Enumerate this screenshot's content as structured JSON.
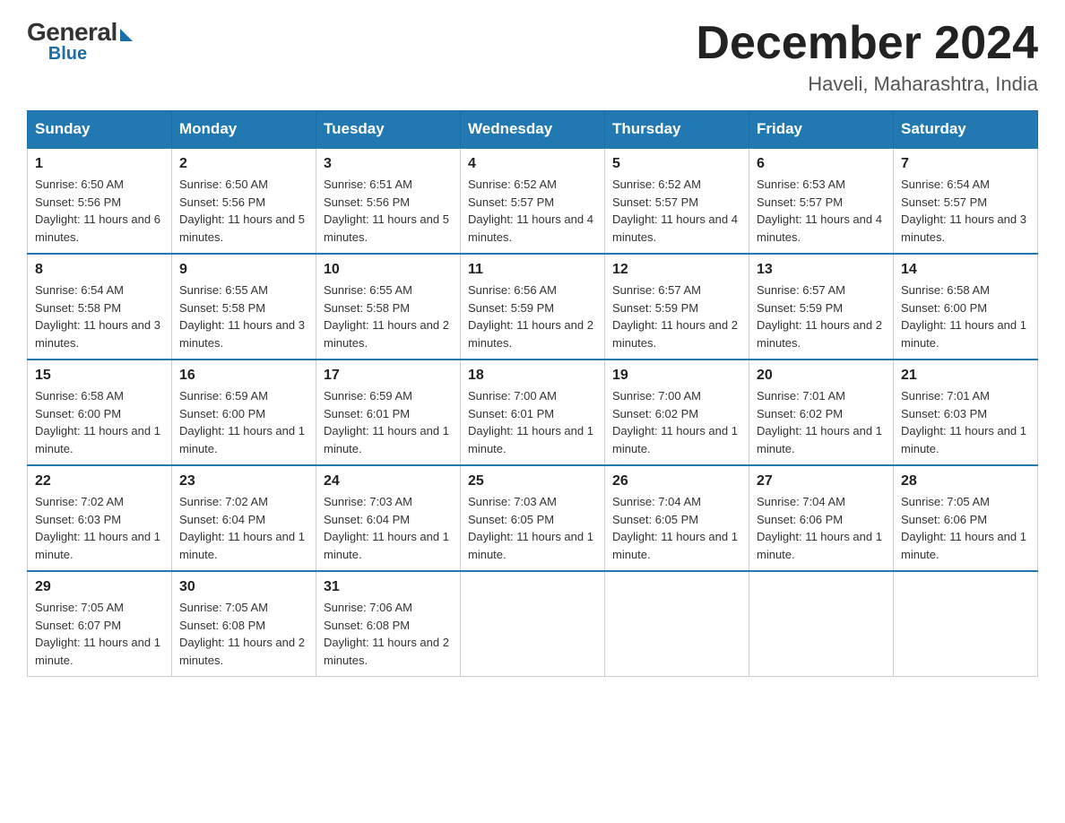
{
  "header": {
    "logo_general": "General",
    "logo_blue": "Blue",
    "month_title": "December 2024",
    "location": "Haveli, Maharashtra, India"
  },
  "days_of_week": [
    "Sunday",
    "Monday",
    "Tuesday",
    "Wednesday",
    "Thursday",
    "Friday",
    "Saturday"
  ],
  "weeks": [
    [
      {
        "day": "1",
        "sunrise": "6:50 AM",
        "sunset": "5:56 PM",
        "daylight": "11 hours and 6 minutes."
      },
      {
        "day": "2",
        "sunrise": "6:50 AM",
        "sunset": "5:56 PM",
        "daylight": "11 hours and 5 minutes."
      },
      {
        "day": "3",
        "sunrise": "6:51 AM",
        "sunset": "5:56 PM",
        "daylight": "11 hours and 5 minutes."
      },
      {
        "day": "4",
        "sunrise": "6:52 AM",
        "sunset": "5:57 PM",
        "daylight": "11 hours and 4 minutes."
      },
      {
        "day": "5",
        "sunrise": "6:52 AM",
        "sunset": "5:57 PM",
        "daylight": "11 hours and 4 minutes."
      },
      {
        "day": "6",
        "sunrise": "6:53 AM",
        "sunset": "5:57 PM",
        "daylight": "11 hours and 4 minutes."
      },
      {
        "day": "7",
        "sunrise": "6:54 AM",
        "sunset": "5:57 PM",
        "daylight": "11 hours and 3 minutes."
      }
    ],
    [
      {
        "day": "8",
        "sunrise": "6:54 AM",
        "sunset": "5:58 PM",
        "daylight": "11 hours and 3 minutes."
      },
      {
        "day": "9",
        "sunrise": "6:55 AM",
        "sunset": "5:58 PM",
        "daylight": "11 hours and 3 minutes."
      },
      {
        "day": "10",
        "sunrise": "6:55 AM",
        "sunset": "5:58 PM",
        "daylight": "11 hours and 2 minutes."
      },
      {
        "day": "11",
        "sunrise": "6:56 AM",
        "sunset": "5:59 PM",
        "daylight": "11 hours and 2 minutes."
      },
      {
        "day": "12",
        "sunrise": "6:57 AM",
        "sunset": "5:59 PM",
        "daylight": "11 hours and 2 minutes."
      },
      {
        "day": "13",
        "sunrise": "6:57 AM",
        "sunset": "5:59 PM",
        "daylight": "11 hours and 2 minutes."
      },
      {
        "day": "14",
        "sunrise": "6:58 AM",
        "sunset": "6:00 PM",
        "daylight": "11 hours and 1 minute."
      }
    ],
    [
      {
        "day": "15",
        "sunrise": "6:58 AM",
        "sunset": "6:00 PM",
        "daylight": "11 hours and 1 minute."
      },
      {
        "day": "16",
        "sunrise": "6:59 AM",
        "sunset": "6:00 PM",
        "daylight": "11 hours and 1 minute."
      },
      {
        "day": "17",
        "sunrise": "6:59 AM",
        "sunset": "6:01 PM",
        "daylight": "11 hours and 1 minute."
      },
      {
        "day": "18",
        "sunrise": "7:00 AM",
        "sunset": "6:01 PM",
        "daylight": "11 hours and 1 minute."
      },
      {
        "day": "19",
        "sunrise": "7:00 AM",
        "sunset": "6:02 PM",
        "daylight": "11 hours and 1 minute."
      },
      {
        "day": "20",
        "sunrise": "7:01 AM",
        "sunset": "6:02 PM",
        "daylight": "11 hours and 1 minute."
      },
      {
        "day": "21",
        "sunrise": "7:01 AM",
        "sunset": "6:03 PM",
        "daylight": "11 hours and 1 minute."
      }
    ],
    [
      {
        "day": "22",
        "sunrise": "7:02 AM",
        "sunset": "6:03 PM",
        "daylight": "11 hours and 1 minute."
      },
      {
        "day": "23",
        "sunrise": "7:02 AM",
        "sunset": "6:04 PM",
        "daylight": "11 hours and 1 minute."
      },
      {
        "day": "24",
        "sunrise": "7:03 AM",
        "sunset": "6:04 PM",
        "daylight": "11 hours and 1 minute."
      },
      {
        "day": "25",
        "sunrise": "7:03 AM",
        "sunset": "6:05 PM",
        "daylight": "11 hours and 1 minute."
      },
      {
        "day": "26",
        "sunrise": "7:04 AM",
        "sunset": "6:05 PM",
        "daylight": "11 hours and 1 minute."
      },
      {
        "day": "27",
        "sunrise": "7:04 AM",
        "sunset": "6:06 PM",
        "daylight": "11 hours and 1 minute."
      },
      {
        "day": "28",
        "sunrise": "7:05 AM",
        "sunset": "6:06 PM",
        "daylight": "11 hours and 1 minute."
      }
    ],
    [
      {
        "day": "29",
        "sunrise": "7:05 AM",
        "sunset": "6:07 PM",
        "daylight": "11 hours and 1 minute."
      },
      {
        "day": "30",
        "sunrise": "7:05 AM",
        "sunset": "6:08 PM",
        "daylight": "11 hours and 2 minutes."
      },
      {
        "day": "31",
        "sunrise": "7:06 AM",
        "sunset": "6:08 PM",
        "daylight": "11 hours and 2 minutes."
      },
      null,
      null,
      null,
      null
    ]
  ]
}
